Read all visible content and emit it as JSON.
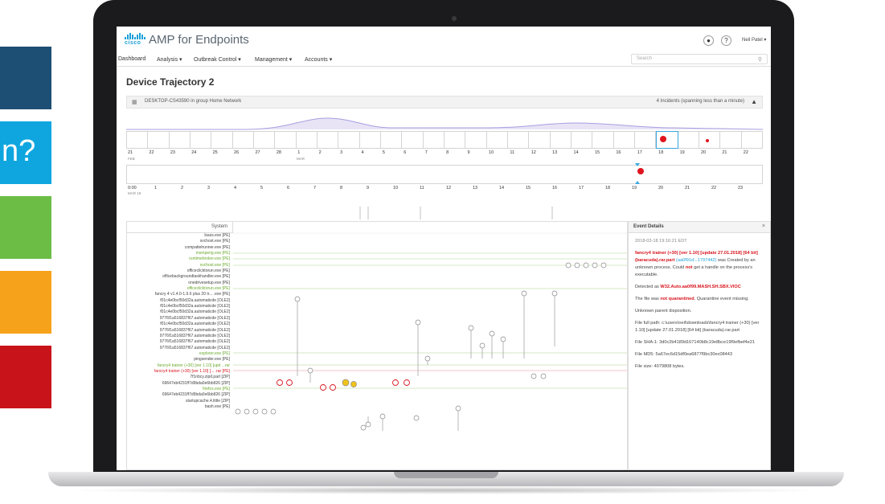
{
  "tiles": [
    {
      "text": "",
      "color": "#1d4e73"
    },
    {
      "text": "n?",
      "color": "#0fa6df"
    },
    {
      "text": "",
      "color": "#6cbd45"
    },
    {
      "text": "",
      "color": "#f7a21b"
    },
    {
      "text": "",
      "color": "#c9131a"
    }
  ],
  "app": {
    "logo_word": "cisco",
    "title": "AMP for Endpoints",
    "user": "Neil Patel",
    "search_placeholder": "Search"
  },
  "nav": {
    "dashboard": "Dashboard",
    "analysis": "Analysis",
    "outbreak_control": "Outbreak Control",
    "management": "Management",
    "accounts": "Accounts"
  },
  "page_title": "Device Trajectory 2",
  "device_bar": {
    "label": "DESKTOP-CS43590 in group Home Network",
    "incidents": "4 Incidents (spanning less than a minute)"
  },
  "timeline": {
    "days": [
      "21",
      "22",
      "23",
      "24",
      "25",
      "26",
      "27",
      "28",
      "1",
      "2",
      "3",
      "4",
      "5",
      "6",
      "7",
      "8",
      "9",
      "10",
      "11",
      "12",
      "13",
      "14",
      "15",
      "16",
      "17",
      "18",
      "19",
      "20",
      "21",
      "22"
    ],
    "month_a": "FEB",
    "month_b": "MAR",
    "hours": [
      "0:00",
      "1",
      "2",
      "3",
      "4",
      "5",
      "6",
      "7",
      "8",
      "9",
      "10",
      "11",
      "12",
      "13",
      "14",
      "15",
      "16",
      "17",
      "18",
      "19",
      "20",
      "21",
      "22",
      "23"
    ],
    "hour_sub": "MAR 18"
  },
  "system_header": "System",
  "processes": [
    {
      "name": "lsass.exe [PE]",
      "kind": "normal"
    },
    {
      "name": "svchost.exe [PE]",
      "kind": "normal"
    },
    {
      "name": "compattelrunner.exe [PE]",
      "kind": "normal"
    },
    {
      "name": "msmpeng.exe [PE]",
      "kind": "green"
    },
    {
      "name": "runtimebroker.exe [PE]",
      "kind": "green"
    },
    {
      "name": "svchost.exe [PE]",
      "kind": "green"
    },
    {
      "name": "officeclicktorun.exe [PE]",
      "kind": "normal"
    },
    {
      "name": "officebackgroundtaskhandler.exe [PE]",
      "kind": "normal"
    },
    {
      "name": "onedrivesetup.exe [PE]",
      "kind": "normal"
    },
    {
      "name": "officeclicktorun.exe [PE]",
      "kind": "green"
    },
    {
      "name": "fancry 4 v1.4.0-1.9.6 plus 20 tr... .exe [PE]",
      "kind": "normal"
    },
    {
      "name": "f01c4e0bcf50d32a.automaticde [OLE2]",
      "kind": "normal"
    },
    {
      "name": "f01c4e0bcf50d32a.automaticde [OLE2]",
      "kind": "normal"
    },
    {
      "name": "f01c4e0bcf50d32a.automaticde [OLE2]",
      "kind": "normal"
    },
    {
      "name": "9776f1a516837f67.automaticde [OLE2]",
      "kind": "normal"
    },
    {
      "name": "f01c4e0bcf50d32a.automaticde [OLE2]",
      "kind": "normal"
    },
    {
      "name": "9776f1a516837f67.automaticde [OLE2]",
      "kind": "normal"
    },
    {
      "name": "9776f1a516837f67.automaticde [OLE2]",
      "kind": "normal"
    },
    {
      "name": "9776f1a516837f67.automaticde [OLE2]",
      "kind": "normal"
    },
    {
      "name": "9776f1a516837f67.automaticde [OLE2]",
      "kind": "normal"
    },
    {
      "name": "explorer.exe [PE]",
      "kind": "green"
    },
    {
      "name": "pingsender.exe [PE]",
      "kind": "normal"
    },
    {
      "name": "fancry4 trainer (+30) [ver 1.10] [upd ...rar",
      "kind": "green"
    },
    {
      "name": "fancry4 trainer (+30) [ver 1.10] [... .rar [PE]",
      "kind": "red"
    },
    {
      "name": "7f1nbcy.zipd.part [ZIP]",
      "kind": "normal"
    },
    {
      "name": "69647eb4231ff7d9bda0e6bb826 [ZIP]",
      "kind": "normal"
    },
    {
      "name": "firefox.exe [PE]",
      "kind": "green"
    },
    {
      "name": "69647eb4231ff7d9bda0e6bb826 [ZIP]",
      "kind": "normal"
    },
    {
      "name": "startupcache.4.little [ZIP]",
      "kind": "normal"
    },
    {
      "name": "bash.exe [PE]",
      "kind": "normal"
    }
  ],
  "event": {
    "header": "Event Details",
    "date": "2018-03-18 19:16:21 EDT",
    "file_title": "fancry4 trainer (+30) [ver 1.10] [update 27.01.2018] [64 bit] (baracuda).rar.part",
    "hash_link": "(aa0f91d...1797442)",
    "created_text": "was Created by an unknown process. Could",
    "not": "not",
    "handle_text": "get a handle on the process's executable.",
    "detected_prefix": "Detected as",
    "detection": "W32.Auto.aa0f99.MASH.SH.SBX.VIOC",
    "quar_prefix": "The file was",
    "not_quarantined": "not quarantined",
    "quar_suffix": ". Quarantine event missing.",
    "disposition": "Unknown parent disposition.",
    "full_path": "File full path: c:\\users\\neil\\downloads\\fancry4 trainer (+30) [ver 1.10] [update 27.01.2018] [64 bit] (baracuda).rar.part",
    "sha1": "File SHA-1: 3d0c2b4189d167140b8c19e8bce19f9efbef4e21",
    "md5": "File MD5: 5a67ec6d15df0ea6877f9bc30ec08443",
    "size": "File size: 4079808 bytes."
  }
}
